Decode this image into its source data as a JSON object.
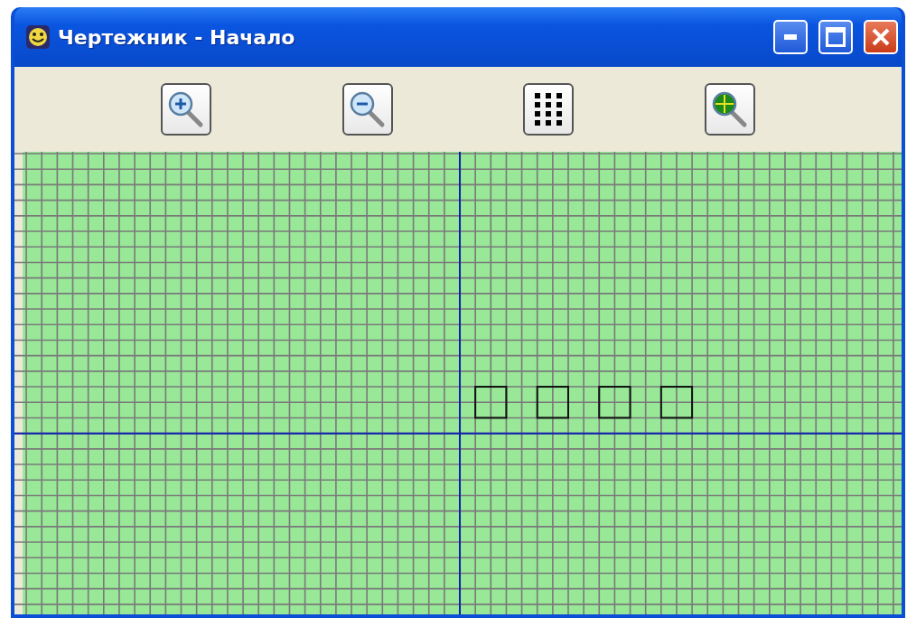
{
  "window": {
    "title": "Чертежник - Начало"
  },
  "toolbar": [
    {
      "kind": "zoom_in"
    },
    {
      "kind": "zoom_out"
    },
    {
      "kind": "grid"
    },
    {
      "kind": "fit"
    }
  ]
}
